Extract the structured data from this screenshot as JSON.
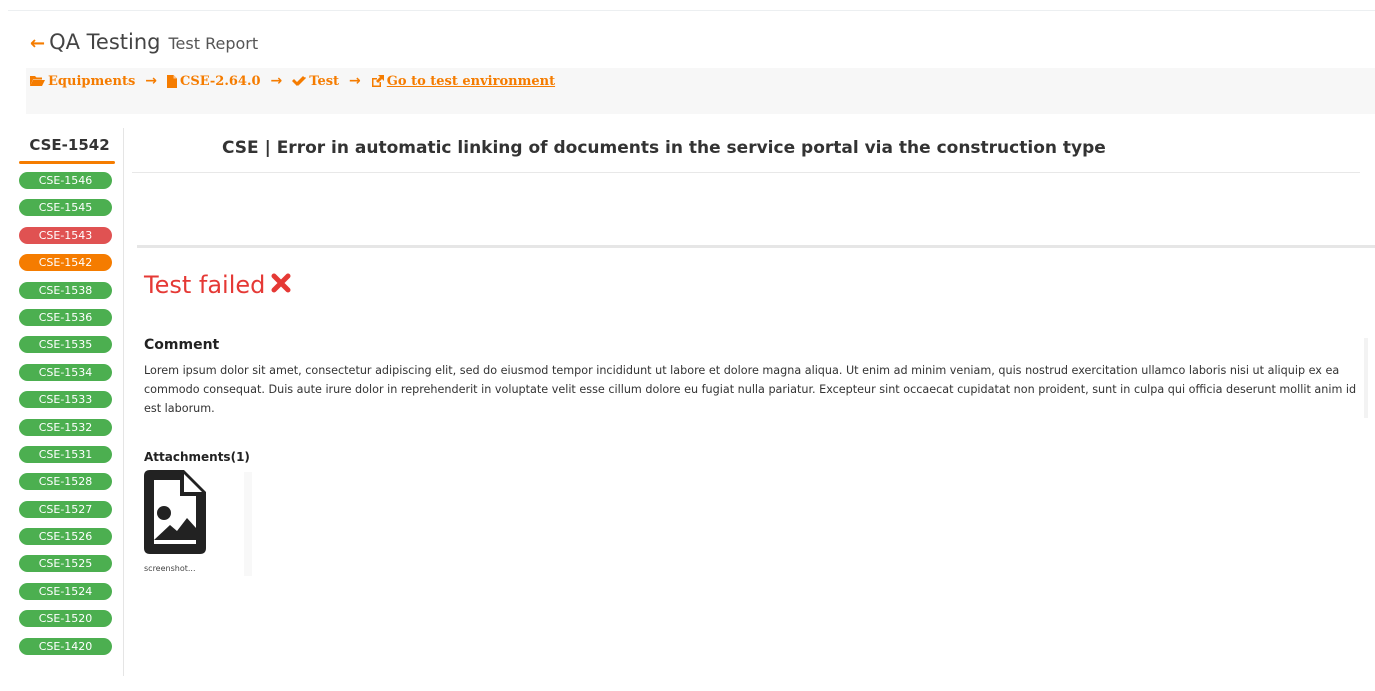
{
  "header": {
    "title": "QA Testing",
    "subtitle": "Test Report"
  },
  "breadcrumb": {
    "items": [
      {
        "label": "Equipments",
        "icon": "folder-open-icon"
      },
      {
        "label": "CSE-2.64.0",
        "icon": "file-icon"
      },
      {
        "label": "Test",
        "icon": "check-double-icon"
      },
      {
        "label": "Go to test environment",
        "icon": "external-link-icon"
      }
    ]
  },
  "sidebar": {
    "current": "CSE-1542",
    "tickets": [
      {
        "id": "CSE-1546",
        "status": "passed"
      },
      {
        "id": "CSE-1545",
        "status": "passed"
      },
      {
        "id": "CSE-1543",
        "status": "failed"
      },
      {
        "id": "CSE-1542",
        "status": "active"
      },
      {
        "id": "CSE-1538",
        "status": "passed"
      },
      {
        "id": "CSE-1536",
        "status": "passed"
      },
      {
        "id": "CSE-1535",
        "status": "passed"
      },
      {
        "id": "CSE-1534",
        "status": "passed"
      },
      {
        "id": "CSE-1533",
        "status": "passed"
      },
      {
        "id": "CSE-1532",
        "status": "passed"
      },
      {
        "id": "CSE-1531",
        "status": "passed"
      },
      {
        "id": "CSE-1528",
        "status": "passed"
      },
      {
        "id": "CSE-1527",
        "status": "passed"
      },
      {
        "id": "CSE-1526",
        "status": "passed"
      },
      {
        "id": "CSE-1525",
        "status": "passed"
      },
      {
        "id": "CSE-1524",
        "status": "passed"
      },
      {
        "id": "CSE-1520",
        "status": "passed"
      },
      {
        "id": "CSE-1420",
        "status": "passed"
      }
    ]
  },
  "issue": {
    "title": "CSE | Error in automatic linking of documents in the service portal via the construction type"
  },
  "result": {
    "label": "Test failed",
    "icon": "x-mark-icon"
  },
  "comment": {
    "heading": "Comment",
    "body": "Lorem ipsum dolor sit amet, consectetur adipiscing elit, sed do eiusmod tempor incididunt ut labore et dolore magna aliqua. Ut enim ad minim veniam, quis nostrud exercitation ullamco laboris nisi ut aliquip ex ea commodo consequat. Duis aute irure dolor in reprehenderit in voluptate velit esse cillum dolore eu fugiat nulla pariatur. Excepteur sint occaecat cupidatat non proident, sunt in culpa qui officia deserunt mollit anim id est laborum."
  },
  "attachments": {
    "heading": "Attachments(1)",
    "items": [
      {
        "name": "screenshot...",
        "icon": "file-image-icon"
      }
    ]
  },
  "colors": {
    "accent": "#f57c00",
    "passed": "#4caf50",
    "failed": "#e05252",
    "error_text": "#e53935"
  }
}
